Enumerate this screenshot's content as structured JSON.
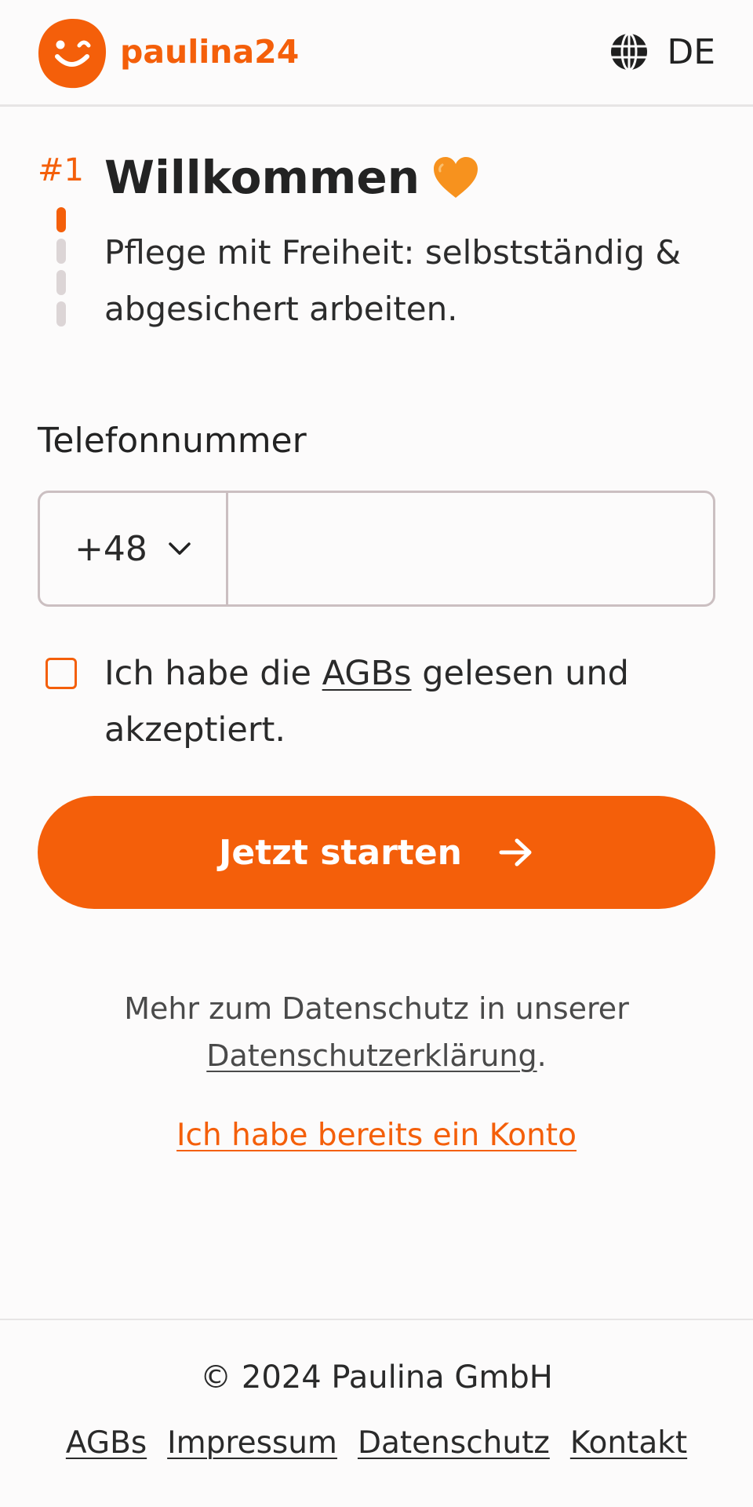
{
  "header": {
    "brand_name": "paulina24",
    "language_label": "DE"
  },
  "step": {
    "number": "#1",
    "current": 1,
    "total": 4
  },
  "welcome": {
    "title": "Willkommen",
    "emoji": "orange-heart",
    "subtitle": "Pflege mit Freiheit: selbstständig & abgesichert arbeiten."
  },
  "phone": {
    "label": "Telefonnummer",
    "country_code": "+48",
    "value": "",
    "placeholder": ""
  },
  "terms": {
    "prefix": "Ich habe die",
    "link": "AGBs",
    "suffix": "gelesen und akzeptiert.",
    "checked": false
  },
  "cta": {
    "label": "Jetzt starten"
  },
  "privacy": {
    "text": "Mehr zum Datenschutz in unserer",
    "link": "Datenschutzerklärung",
    "period": "."
  },
  "login_link": "Ich habe bereits ein Konto",
  "footer": {
    "copyright": "© 2024 Paulina GmbH",
    "links": [
      "AGBs",
      "Impressum",
      "Datenschutz",
      "Kontakt"
    ]
  },
  "colors": {
    "accent": "#f45f0a",
    "background": "#fcfbfb",
    "border": "#cbbfc1",
    "step_inactive": "#dcd5d6"
  }
}
